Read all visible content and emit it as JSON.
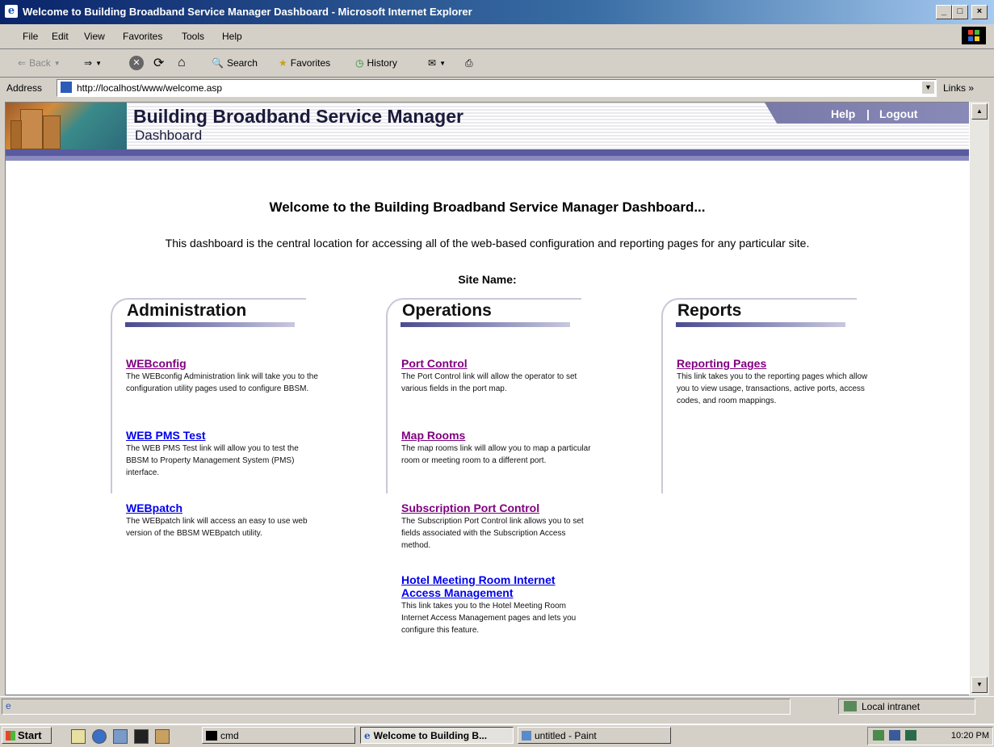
{
  "window": {
    "title": "Welcome to Building Broadband Service Manager Dashboard - Microsoft Internet Explorer",
    "min": "_",
    "max": "□",
    "close": "×"
  },
  "menu": [
    "File",
    "Edit",
    "View",
    "Favorites",
    "Tools",
    "Help"
  ],
  "toolbar": {
    "back": "Back",
    "search": "Search",
    "favorites": "Favorites",
    "history": "History"
  },
  "address": {
    "label": "Address",
    "url": "http://localhost/www/welcome.asp",
    "links": "Links »"
  },
  "banner": {
    "title": "Building Broadband Service Manager",
    "subtitle": "Dashboard",
    "help": "Help",
    "separator": "|",
    "logout": "Logout"
  },
  "main": {
    "welcome": "Welcome to the Building Broadband Service Manager Dashboard...",
    "intro": "This dashboard is the central location for accessing all of the web-based configuration and reporting pages for any particular site.",
    "site_label": "Site Name:"
  },
  "columns": [
    {
      "title": "Administration",
      "entries": [
        {
          "link": "WEBconfig",
          "visited": true,
          "desc": "The WEBconfig Administration link will take you to the configuration utility pages used to configure BBSM."
        },
        {
          "link": "WEB PMS Test",
          "visited": false,
          "desc": "The WEB PMS Test link will allow you to test the BBSM to Property Management System (PMS) interface."
        },
        {
          "link": "WEBpatch",
          "visited": false,
          "desc": "The WEBpatch link will access an easy to use web version of the BBSM WEBpatch utility."
        }
      ]
    },
    {
      "title": "Operations",
      "entries": [
        {
          "link": "Port Control",
          "visited": true,
          "desc": "The Port Control link will allow the operator to set various fields in the port map."
        },
        {
          "link": "Map Rooms",
          "visited": true,
          "desc": "The map rooms link will allow you to map a particular room or meeting room to a different port."
        },
        {
          "link": "Subscription Port Control",
          "visited": true,
          "desc": "The Subscription Port Control link allows you to set fields associated with the Subscription Access method."
        },
        {
          "link": "Hotel Meeting Room Internet Access Management",
          "visited": false,
          "desc": "This link takes you to the Hotel Meeting Room Internet Access Management pages and lets you configure this feature."
        }
      ]
    },
    {
      "title": "Reports",
      "entries": [
        {
          "link": "Reporting Pages",
          "visited": true,
          "desc": "This link takes you to the reporting pages which allow you to view usage, transactions, active ports, access codes, and room mappings."
        }
      ]
    }
  ],
  "status": {
    "zone": "Local intranet"
  },
  "taskbar": {
    "start": "Start",
    "tasks": [
      "cmd",
      "Welcome to Building B...",
      "untitled - Paint"
    ],
    "clock": "10:20 PM"
  },
  "colors": {
    "visited_link": "#800080",
    "unvisited_link": "#0000ee",
    "banner_stripe": "#5a5aa0",
    "titlebar": "#0a246a"
  }
}
